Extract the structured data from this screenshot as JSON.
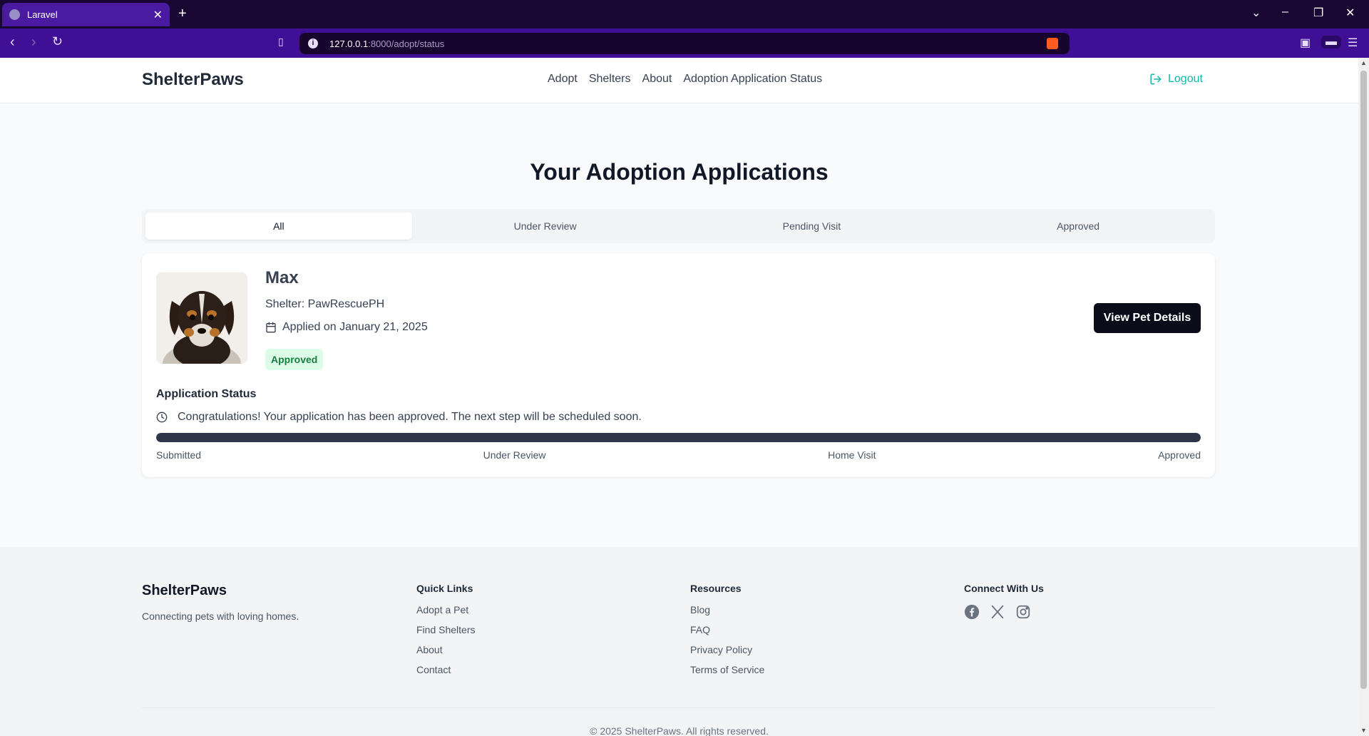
{
  "browser": {
    "tab_title": "Laravel",
    "url_host": "127.0.0.1",
    "url_path": ":8000/adopt/status"
  },
  "site": {
    "brand": "ShelterPaws",
    "nav": [
      "Adopt",
      "Shelters",
      "About",
      "Adoption Application Status"
    ],
    "logout": "Logout"
  },
  "page": {
    "title": "Your Adoption Applications",
    "tabs": [
      "All",
      "Under Review",
      "Pending Visit",
      "Approved"
    ],
    "active_tab": "All"
  },
  "application": {
    "pet_name": "Max",
    "shelter": "Shelter: PawRescuePH",
    "applied": "Applied on January 21, 2025",
    "badge": "Approved",
    "view_button": "View Pet Details",
    "status_heading": "Application Status",
    "status_message": "Congratulations! Your application has been approved. The next step will be scheduled soon.",
    "progress": 1.0,
    "steps": [
      "Submitted",
      "Under Review",
      "Home Visit",
      "Approved"
    ],
    "colors": {
      "badge_bg": "#dcfce7",
      "badge_text": "#15803d",
      "progress_fill": "#2d3748"
    }
  },
  "footer": {
    "brand": "ShelterPaws",
    "tagline": "Connecting pets with loving homes.",
    "quick_links_title": "Quick Links",
    "quick_links": [
      "Adopt a Pet",
      "Find Shelters",
      "About",
      "Contact"
    ],
    "resources_title": "Resources",
    "resources": [
      "Blog",
      "FAQ",
      "Privacy Policy",
      "Terms of Service"
    ],
    "connect_title": "Connect With Us",
    "social_icons": [
      "facebook-icon",
      "x-icon",
      "instagram-icon"
    ],
    "copyright": "© 2025 ShelterPaws. All rights reserved."
  },
  "accent_color": "#14b8a6"
}
